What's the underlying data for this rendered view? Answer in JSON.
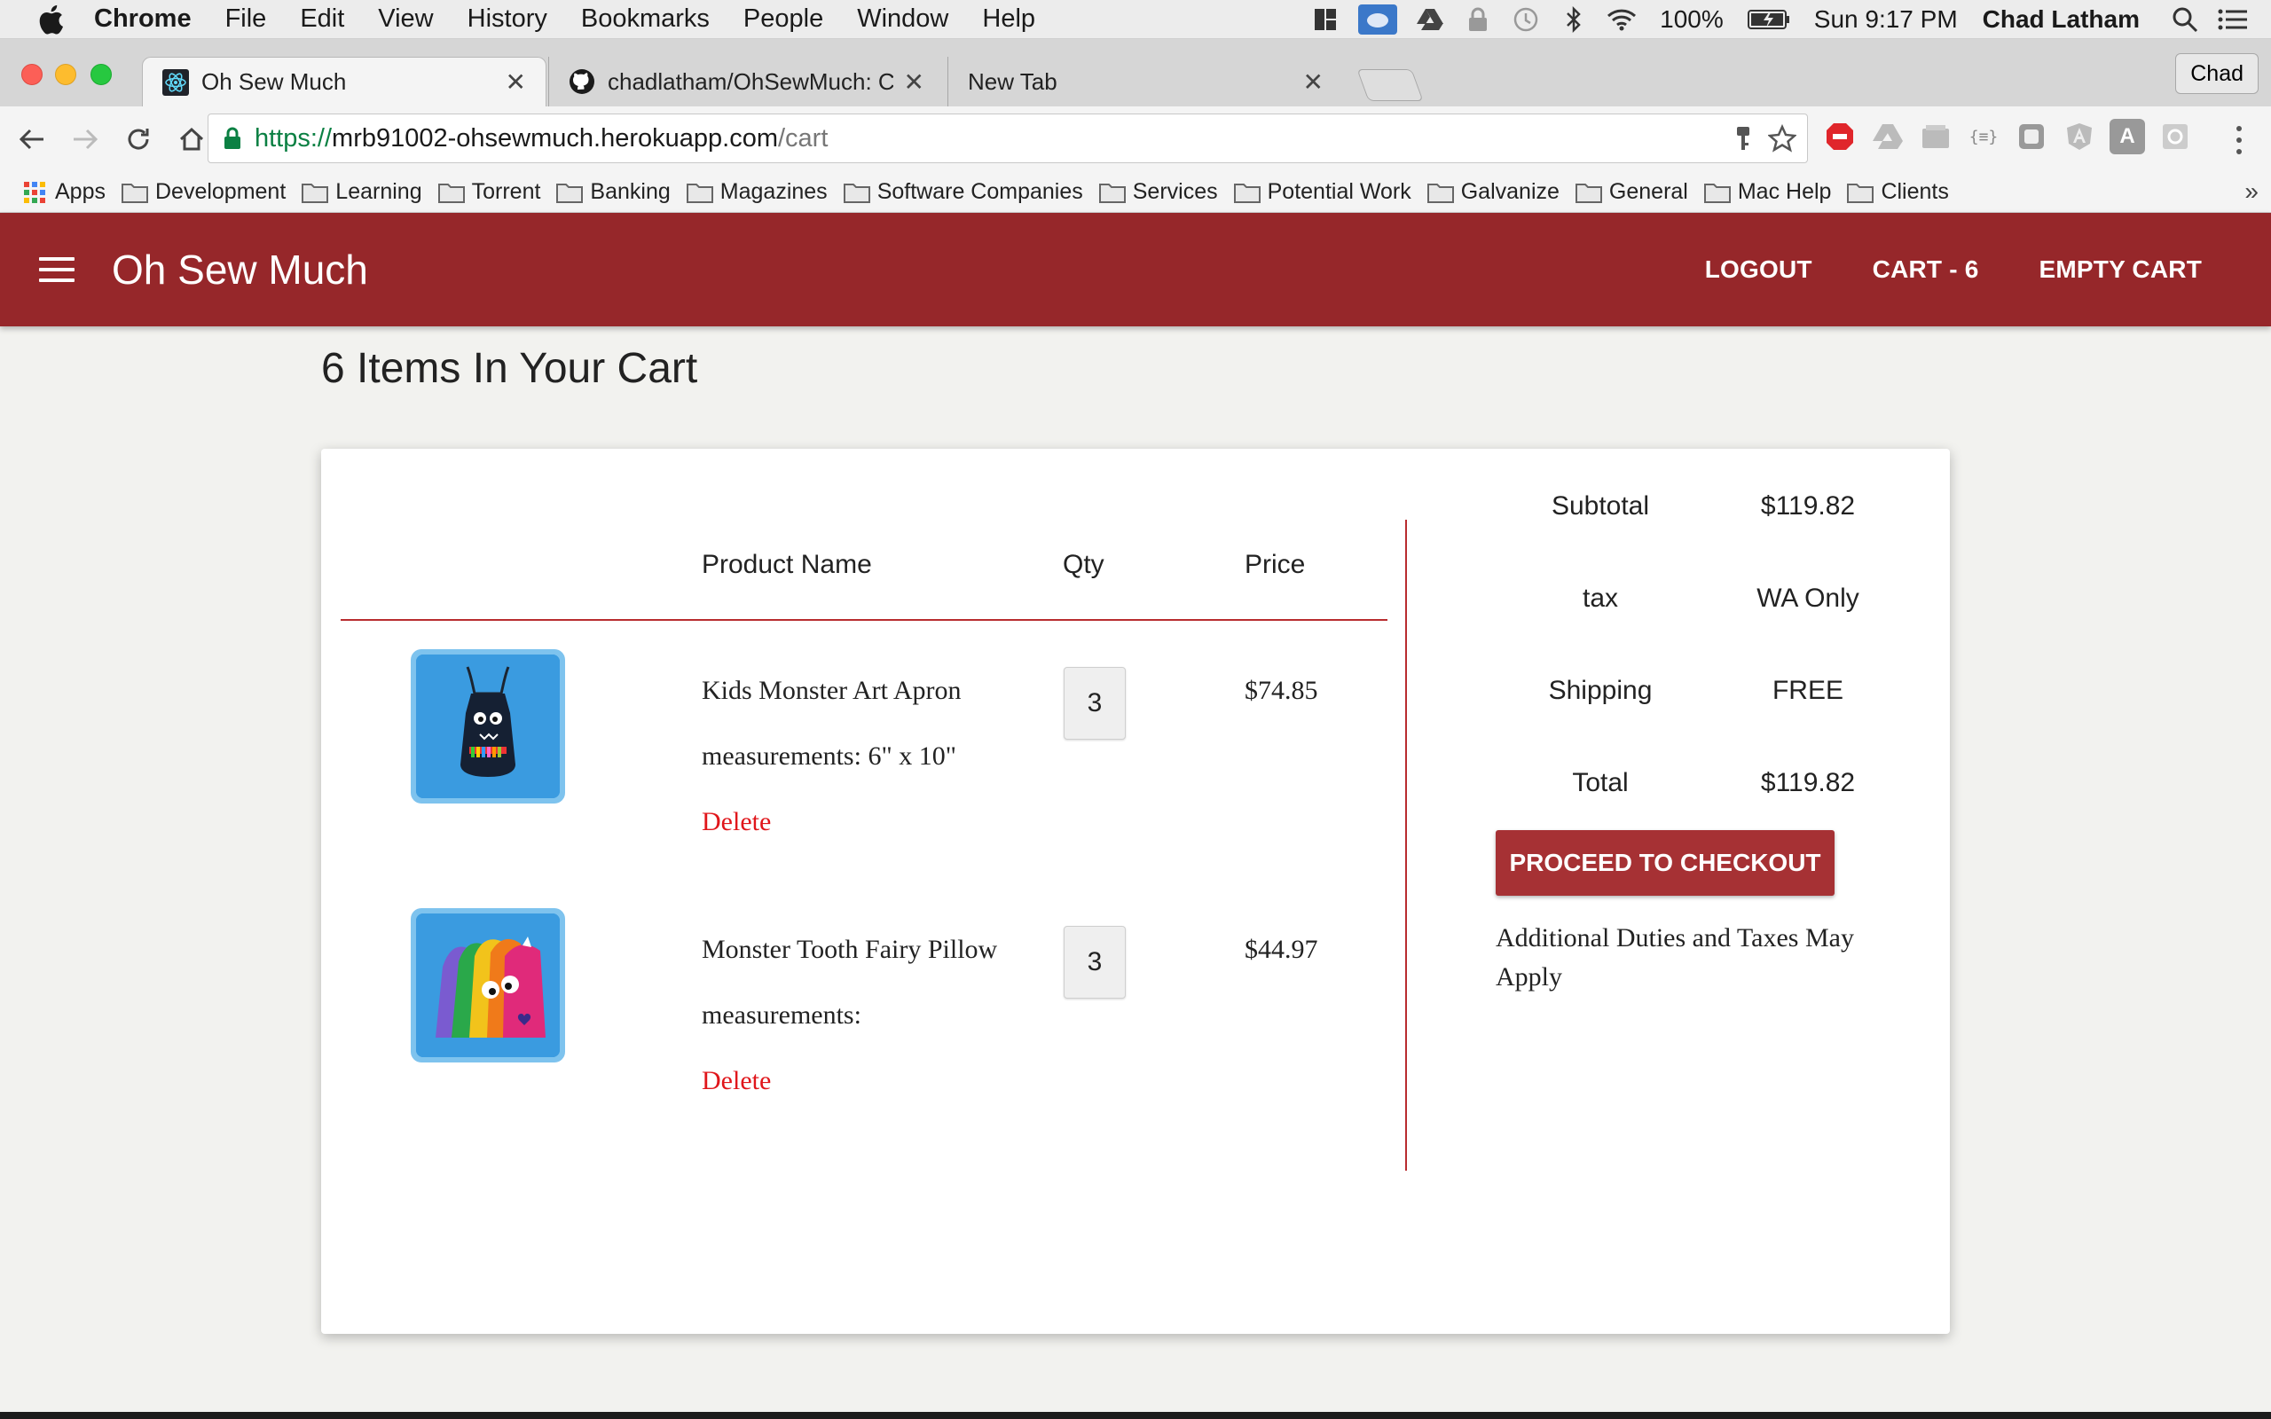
{
  "menubar": {
    "app_name": "Chrome",
    "items": [
      "File",
      "Edit",
      "View",
      "History",
      "Bookmarks",
      "People",
      "Window",
      "Help"
    ],
    "battery": "100%",
    "clock": "Sun 9:17 PM",
    "user": "Chad Latham"
  },
  "tabs": [
    {
      "title": "Oh Sew Much",
      "icon": "react-icon"
    },
    {
      "title": "chadlatham/OhSewMuch: Cust",
      "icon": "github-icon"
    },
    {
      "title": "New Tab",
      "icon": ""
    }
  ],
  "profile": "Chad",
  "address": {
    "scheme": "https://",
    "host": "mrb91002-ohsewmuch.herokuapp.com",
    "path": "/cart"
  },
  "bookmarks": [
    "Apps",
    "Development",
    "Learning",
    "Torrent",
    "Banking",
    "Magazines",
    "Software Companies",
    "Services",
    "Potential Work",
    "Galvanize",
    "General",
    "Mac Help",
    "Clients"
  ],
  "header": {
    "brand": "Oh Sew Much",
    "nav": {
      "logout": "LOGOUT",
      "cart": "CART - 6",
      "empty_cart": "EMPTY CART"
    }
  },
  "page": {
    "heading": "6 Items In Your Cart"
  },
  "cart": {
    "columns": {
      "name": "Product Name",
      "qty": "Qty",
      "price": "Price"
    },
    "items": [
      {
        "name": "Kids Monster Art Apron",
        "measurements": "measurements: 6\" x 10\"",
        "qty": "3",
        "price": "$74.85",
        "delete": "Delete"
      },
      {
        "name": "Monster Tooth Fairy Pillow",
        "measurements": "measurements:",
        "qty": "3",
        "price": "$44.97",
        "delete": "Delete"
      }
    ]
  },
  "summary": {
    "subtotal_label": "Subtotal",
    "subtotal_value": "$119.82",
    "tax_label": "tax",
    "tax_value": "WA Only",
    "shipping_label": "Shipping",
    "shipping_value": "FREE",
    "total_label": "Total",
    "total_value": "$119.82",
    "checkout": "PROCEED TO CHECKOUT",
    "note": "Additional Duties and Taxes May Apply"
  },
  "colors": {
    "brand": "#96272a",
    "button": "#a63134",
    "accent_rule": "#b82c2f",
    "delete": "#e0161b"
  }
}
